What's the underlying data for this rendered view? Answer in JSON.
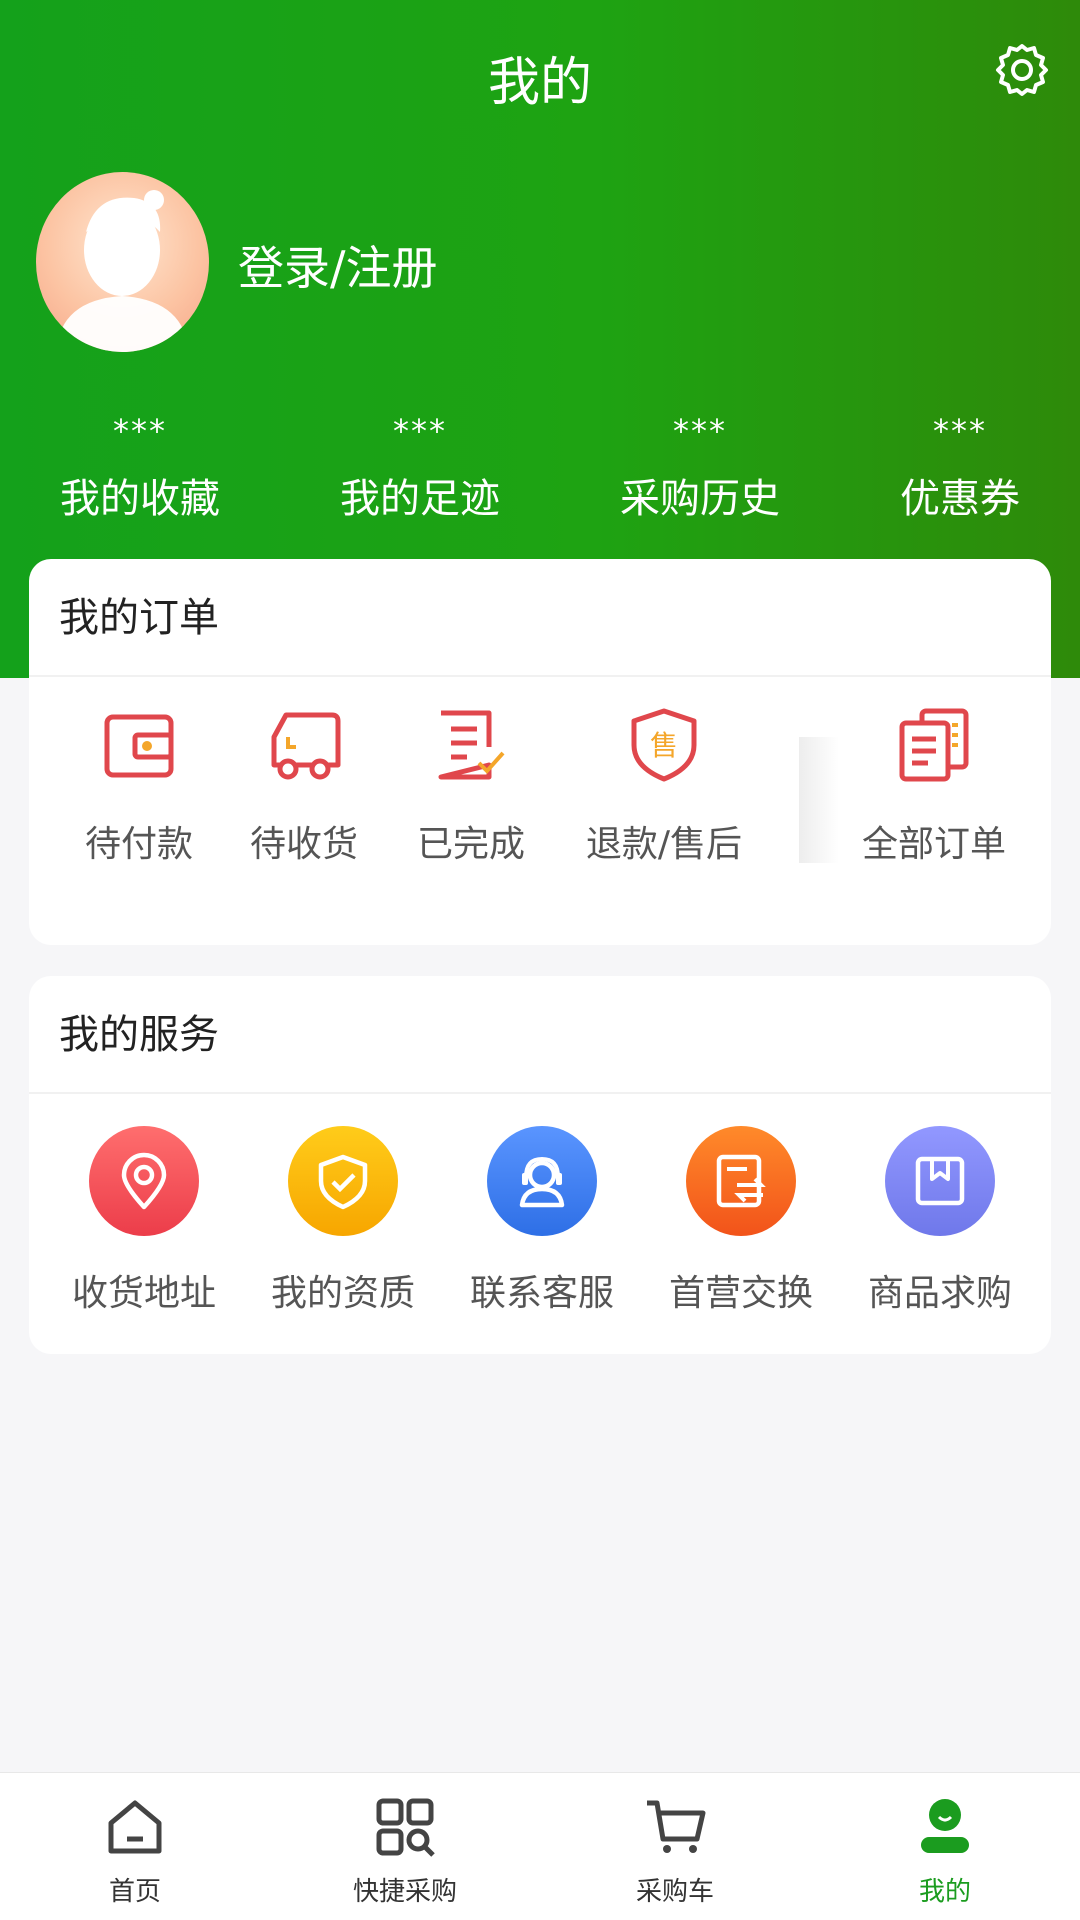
{
  "header": {
    "title": "我的",
    "login_label": "登录/注册"
  },
  "stats": [
    {
      "value": "***",
      "label": "我的收藏"
    },
    {
      "value": "***",
      "label": "我的足迹"
    },
    {
      "value": "***",
      "label": "采购历史"
    },
    {
      "value": "***",
      "label": "优惠券"
    }
  ],
  "orders": {
    "title": "我的订单",
    "items": [
      {
        "label": "待付款",
        "icon": "wallet-icon"
      },
      {
        "label": "待收货",
        "icon": "truck-icon"
      },
      {
        "label": "已完成",
        "icon": "completed-doc-icon"
      },
      {
        "label": "退款/售后",
        "icon": "after-sale-shield-icon"
      },
      {
        "label": "全部订单",
        "icon": "all-orders-icon"
      }
    ],
    "refund_badge": "售"
  },
  "services": {
    "title": "我的服务",
    "items": [
      {
        "label": "收货地址",
        "icon": "location-pin-icon",
        "color": "#f4525a"
      },
      {
        "label": "我的资质",
        "icon": "shield-check-icon",
        "color": "#f8b400"
      },
      {
        "label": "联系客服",
        "icon": "customer-service-icon",
        "color": "#3d7ef2"
      },
      {
        "label": "首营交换",
        "icon": "exchange-doc-icon",
        "color": "#f76a1c"
      },
      {
        "label": "商品求购",
        "icon": "box-icon",
        "color": "#7f86f0"
      }
    ]
  },
  "tabbar": {
    "items": [
      {
        "label": "首页",
        "icon": "home-icon"
      },
      {
        "label": "快捷采购",
        "icon": "quick-purchase-icon"
      },
      {
        "label": "采购车",
        "icon": "cart-icon"
      },
      {
        "label": "我的",
        "icon": "profile-icon"
      }
    ]
  },
  "colors": {
    "brand_green": "#1b9c1f",
    "order_icon_red": "#e0474c",
    "order_icon_accent": "#f4a62a"
  }
}
